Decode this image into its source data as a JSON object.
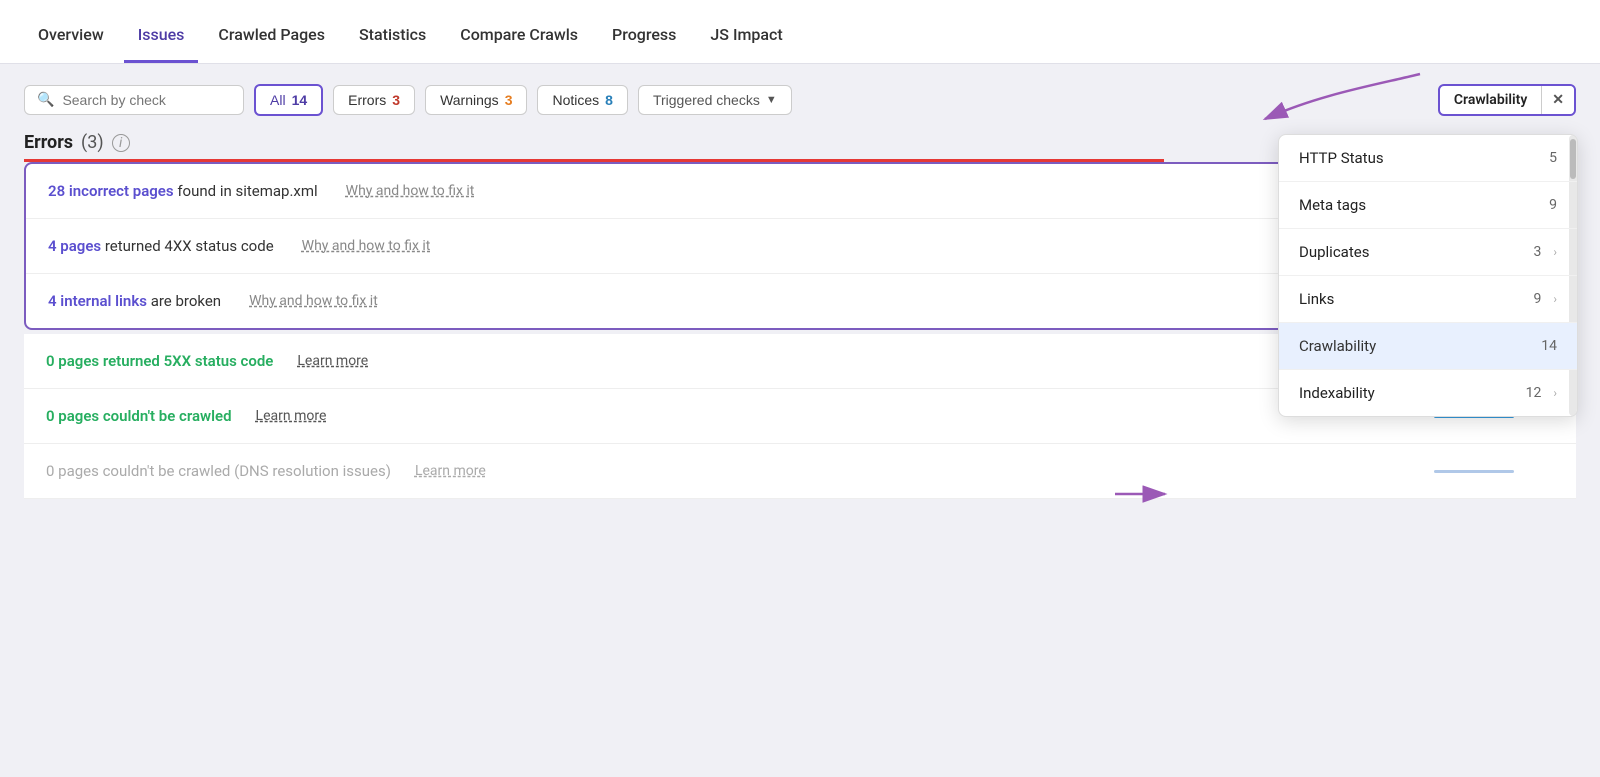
{
  "nav": {
    "items": [
      {
        "label": "Overview",
        "active": false
      },
      {
        "label": "Issues",
        "active": true
      },
      {
        "label": "Crawled Pages",
        "active": false
      },
      {
        "label": "Statistics",
        "active": false
      },
      {
        "label": "Compare Crawls",
        "active": false
      },
      {
        "label": "Progress",
        "active": false
      },
      {
        "label": "JS Impact",
        "active": false
      }
    ]
  },
  "filter_bar": {
    "search_placeholder": "Search by check",
    "all_label": "All",
    "all_count": "14",
    "errors_label": "Errors",
    "errors_count": "3",
    "warnings_label": "Warnings",
    "warnings_count": "3",
    "notices_label": "Notices",
    "notices_count": "8",
    "triggered_label": "Triggered checks",
    "crawlability_label": "Crawlability",
    "close_label": "✕"
  },
  "errors_section": {
    "heading": "Errors",
    "count": "(3)",
    "items": [
      {
        "prefix": "28 incorrect pages",
        "suffix": " found in sitemap.xml",
        "fix_text": "Why and how to fix it"
      },
      {
        "prefix": "4 pages",
        "suffix": " returned 4XX status code",
        "fix_text": "Why and how to fix it"
      },
      {
        "prefix": "4 internal links",
        "suffix": " are broken",
        "fix_text": "Why and how to fix it"
      }
    ]
  },
  "green_items": [
    {
      "prefix": "0 pages returned 5XX status code",
      "learn_text": "Learn more"
    },
    {
      "prefix": "0 pages couldn't be crawled",
      "learn_text": "Learn more"
    },
    {
      "prefix": "0 pages couldn't be crawled (DNS resolution issues)",
      "learn_text": "Learn more",
      "muted": true
    }
  ],
  "dropdown": {
    "items": [
      {
        "label": "HTTP Status",
        "count": "5",
        "selected": false
      },
      {
        "label": "Meta tags",
        "count": "9",
        "selected": false
      },
      {
        "label": "Duplicates",
        "count": "3",
        "selected": false,
        "has_chevron": true
      },
      {
        "label": "Links",
        "count": "9",
        "selected": false,
        "has_chevron": true
      },
      {
        "label": "Crawlability",
        "count": "14",
        "selected": true
      },
      {
        "label": "Indexability",
        "count": "12",
        "selected": false,
        "has_chevron": true
      }
    ]
  }
}
